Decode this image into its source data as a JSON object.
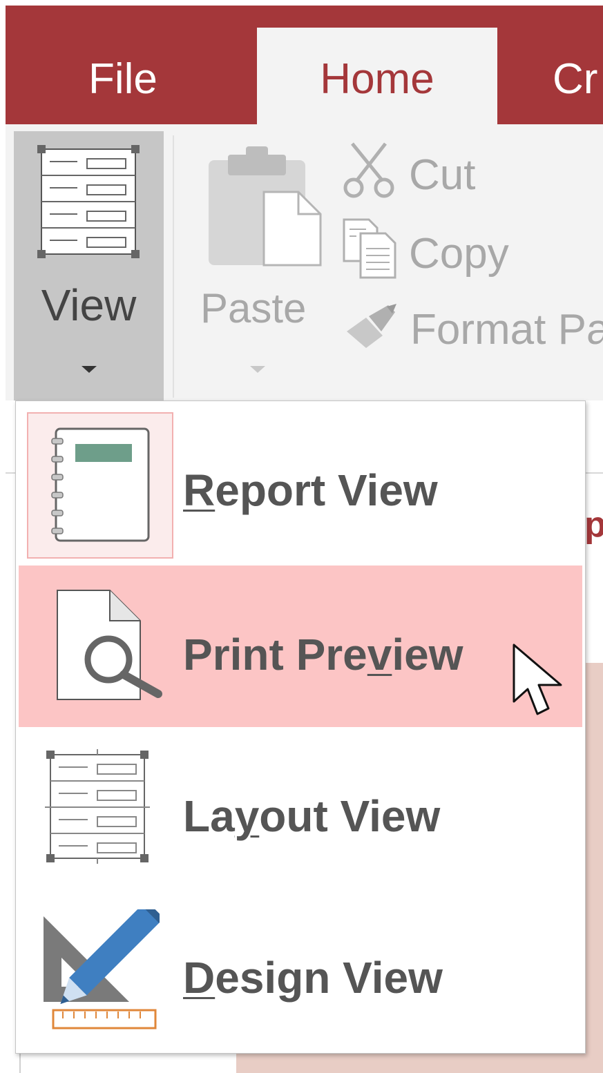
{
  "tabs": {
    "file": "File",
    "home": "Home",
    "create": "Cr"
  },
  "ribbon": {
    "view_label": "View",
    "paste_label": "Paste",
    "cut_label": "Cut",
    "copy_label": "Copy",
    "format_painter_label": "Format Pa"
  },
  "background": {
    "peek_text": "p"
  },
  "menu": {
    "items": [
      {
        "prefix": "",
        "underline": "R",
        "suffix": "eport View",
        "icon": "report-view-icon",
        "state": "current"
      },
      {
        "prefix": "Print Pre",
        "underline": "v",
        "suffix": "iew",
        "icon": "print-preview-icon",
        "state": "hover"
      },
      {
        "prefix": "La",
        "underline": "y",
        "suffix": "out View",
        "icon": "layout-view-icon",
        "state": "normal"
      },
      {
        "prefix": "",
        "underline": "D",
        "suffix": "esign View",
        "icon": "design-view-icon",
        "state": "normal"
      }
    ]
  },
  "colors": {
    "accent": "#a4373a",
    "ribbon_bg": "#f3f3f3",
    "hover_bg": "#fcc5c5",
    "current_bg": "#fbecec",
    "design_pencil": "#3f7fc1",
    "design_ruler": "#e0873a"
  }
}
